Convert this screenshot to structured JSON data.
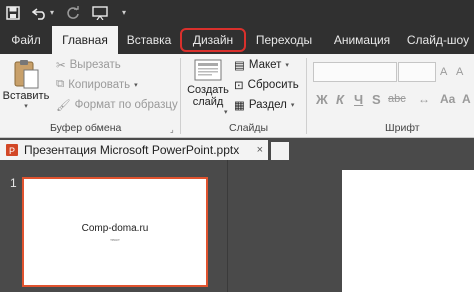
{
  "qat": {
    "save_icon": "save-icon",
    "undo_icon": "undo-icon",
    "repeat_icon": "repeat-icon",
    "slideshow_icon": "slideshow-from-start-icon"
  },
  "tabs": [
    {
      "label": "Файл"
    },
    {
      "label": "Главная"
    },
    {
      "label": "Вставка"
    },
    {
      "label": "Дизайн"
    },
    {
      "label": "Переходы"
    },
    {
      "label": "Анимация"
    },
    {
      "label": "Слайд-шоу"
    }
  ],
  "ribbon": {
    "clipboard": {
      "paste_label": "Вставить",
      "cut_label": "Вырезать",
      "copy_label": "Копировать",
      "format_painter_label": "Формат по образцу",
      "group_label": "Буфер обмена"
    },
    "slides": {
      "new_slide_label_1": "Создать",
      "new_slide_label_2": "слайд",
      "layout_label": "Макет",
      "reset_label": "Сбросить",
      "section_label": "Раздел",
      "group_label": "Слайды"
    },
    "font": {
      "bold": "Ж",
      "italic": "К",
      "underline": "Ч",
      "strike": "S",
      "abc": "abc",
      "group_label": "Шрифт"
    }
  },
  "document": {
    "tab_title": "Презентация Microsoft PowerPoint.pptx",
    "close_glyph": "×"
  },
  "slides": {
    "number": "1",
    "thumb_title": "Comp-doma.ru",
    "thumb_subtitle": "текст"
  },
  "colors": {
    "accent_red": "#d9302c",
    "thumb_border": "#e0532f",
    "title_bar": "#303030"
  }
}
